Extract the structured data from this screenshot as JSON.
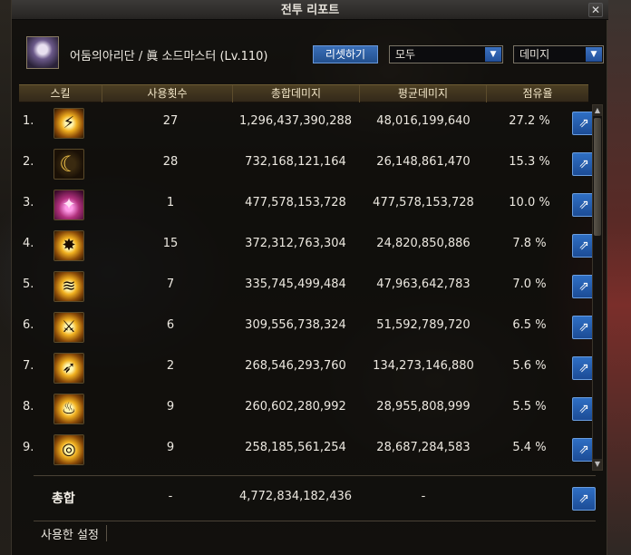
{
  "window": {
    "title": "전투 리포트",
    "close_label": "✕"
  },
  "header": {
    "character": "어둠의아리단 / 眞 소드마스터 (Lv.110)",
    "reset_label": "리셋하기",
    "filter_target": "모두",
    "filter_metric": "데미지",
    "dropdown_arrow": "▼"
  },
  "columns": {
    "skill": "스킬",
    "uses": "사용횟수",
    "total": "총합데미지",
    "avg": "평균데미지",
    "share": "점유율"
  },
  "rows": [
    {
      "rank": "1.",
      "icon": "slash-skill-icon",
      "glyph": "⚡",
      "uses": "27",
      "total": "1,296,437,390,288",
      "avg": "48,016,199,640",
      "share": "27.2 %"
    },
    {
      "rank": "2.",
      "icon": "crescent-moon-skill-icon",
      "glyph": "☾",
      "uses": "28",
      "total": "732,168,121,164",
      "avg": "26,148,861,470",
      "share": "15.3 %"
    },
    {
      "rank": "3.",
      "icon": "character-portrait-skill-icon",
      "glyph": "✦",
      "uses": "1",
      "total": "477,578,153,728",
      "avg": "477,578,153,728",
      "share": "10.0 %"
    },
    {
      "rank": "4.",
      "icon": "burst-skill-icon",
      "glyph": "✸",
      "uses": "15",
      "total": "372,312,763,304",
      "avg": "24,820,850,886",
      "share": "7.8 %"
    },
    {
      "rank": "5.",
      "icon": "wave-skill-icon",
      "glyph": "≋",
      "uses": "7",
      "total": "335,745,499,484",
      "avg": "47,963,642,783",
      "share": "7.0 %"
    },
    {
      "rank": "6.",
      "icon": "sword-skill-icon",
      "glyph": "⚔",
      "uses": "6",
      "total": "309,556,738,324",
      "avg": "51,592,789,720",
      "share": "6.5 %"
    },
    {
      "rank": "7.",
      "icon": "blade-strike-skill-icon",
      "glyph": "➶",
      "uses": "2",
      "total": "268,546,293,760",
      "avg": "134,273,146,880",
      "share": "5.6 %"
    },
    {
      "rank": "8.",
      "icon": "flame-pillar-skill-icon",
      "glyph": "♨",
      "uses": "9",
      "total": "260,602,280,992",
      "avg": "28,955,808,999",
      "share": "5.5 %"
    },
    {
      "rank": "9.",
      "icon": "spiral-skill-icon",
      "glyph": "◎",
      "uses": "9",
      "total": "258,185,561,254",
      "avg": "28,687,284,583",
      "share": "5.4 %"
    }
  ],
  "total": {
    "label": "총합",
    "uses": "-",
    "total": "4,772,834,182,436",
    "avg": "-"
  },
  "settings": {
    "label": "사용한 설정"
  },
  "share_icon_glyph": "⇗",
  "scroll": {
    "up": "▲",
    "down": "▼",
    "position": 0.0
  }
}
